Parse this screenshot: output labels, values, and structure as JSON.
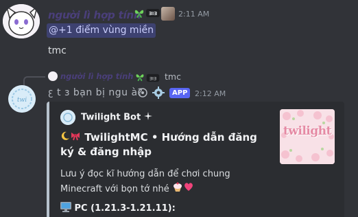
{
  "message1": {
    "username": "người lì hợp tính",
    "timestamp": "2:11 AM",
    "mention": "@+1 điểm vùng miền",
    "body": "tmc"
  },
  "reply": {
    "username": "người lì hợp tính",
    "text": "tmc"
  },
  "message2": {
    "bot_name": "ꜫ t ɜ bạn bị ngu à?",
    "app_tag": "APP",
    "timestamp": "2:12 AM"
  },
  "embed": {
    "author": "Twilight Bot",
    "title": "TwilightMC • Hướng dẫn đăng ký & đăng nhập",
    "description": "Lưu ý đọc kĩ hướng dẫn để chơi chung Minecraft với bọn tớ nhé",
    "field_name": "PC (1.21.3-1.21.11):",
    "thumbnail_text": "twilight",
    "accent_color": "#b7c2cd"
  },
  "icons": {
    "role": "butterfly-role-icon",
    "bot": "gear-bot-icon"
  }
}
